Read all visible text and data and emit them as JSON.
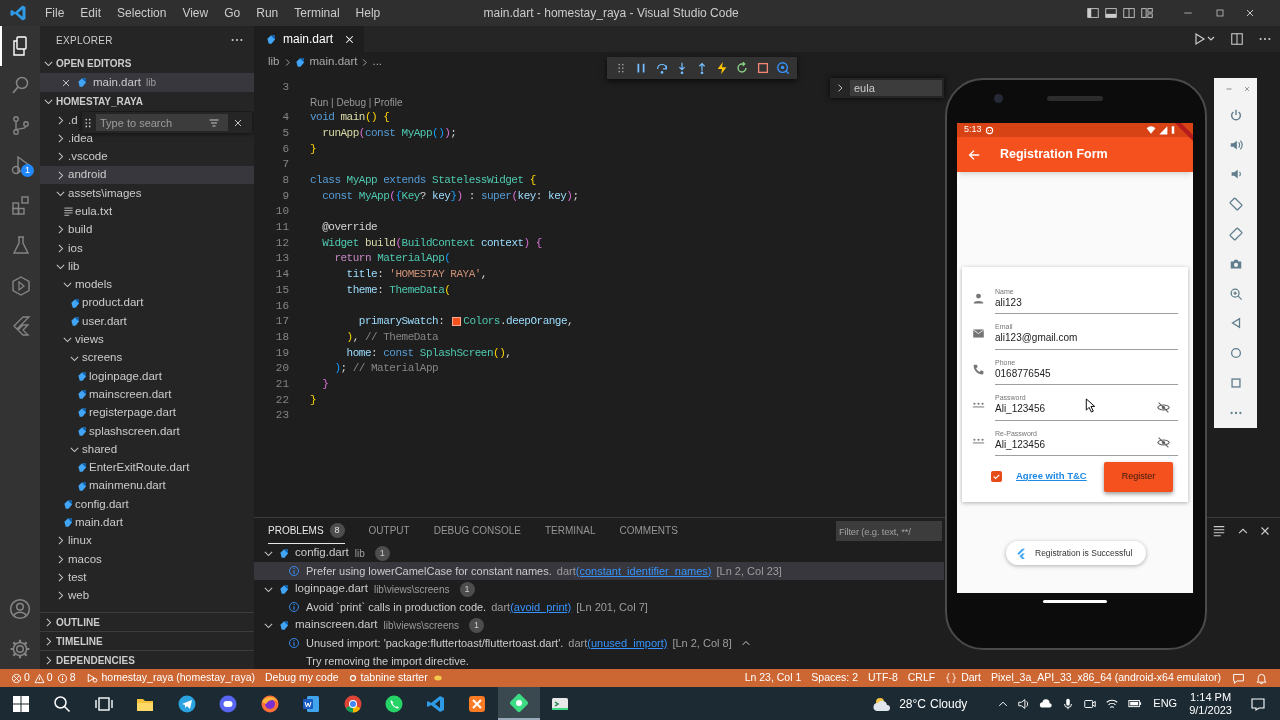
{
  "window": {
    "title": "main.dart - homestay_raya - Visual Studio Code"
  },
  "menu": [
    "File",
    "Edit",
    "Selection",
    "View",
    "Go",
    "Run",
    "Terminal",
    "Help"
  ],
  "activity_bar": [
    {
      "kind": "explorer",
      "selected": true
    },
    {
      "kind": "search",
      "selected": false
    },
    {
      "kind": "source-control",
      "selected": false
    },
    {
      "kind": "run-debug",
      "selected": false,
      "badge": "1"
    },
    {
      "kind": "extensions",
      "selected": false
    },
    {
      "kind": "testing",
      "selected": false
    },
    {
      "kind": "remote",
      "selected": false
    },
    {
      "kind": "flutter",
      "selected": false
    }
  ],
  "activity_bar_bottom": [
    {
      "kind": "account"
    },
    {
      "kind": "settings"
    }
  ],
  "sidebar": {
    "title": "EXPLORER",
    "open_editors": {
      "header": "OPEN EDITORS",
      "expanded": true,
      "items": [
        {
          "name": "main.dart",
          "path": "lib",
          "selected": true
        }
      ]
    },
    "project": {
      "header": "HOMESTAY_RAYA",
      "expanded": true,
      "tree": [
        {
          "name": ".d",
          "kind": "folder",
          "expanded": false,
          "selected": false
        },
        {
          "name": ".idea",
          "kind": "folder",
          "expanded": false,
          "selected": false
        },
        {
          "name": ".vscode",
          "kind": "folder",
          "expanded": false,
          "selected": false
        },
        {
          "name": "android",
          "kind": "folder",
          "expanded": false,
          "selected": true
        },
        {
          "name": "assets\\images",
          "kind": "folder",
          "expanded": true,
          "selected": false,
          "children": [
            {
              "name": "eula.txt",
              "kind": "text",
              "selected": false
            }
          ]
        },
        {
          "name": "build",
          "kind": "folder",
          "expanded": false,
          "selected": false
        },
        {
          "name": "ios",
          "kind": "folder",
          "expanded": false,
          "selected": false
        },
        {
          "name": "lib",
          "kind": "folder",
          "expanded": true,
          "selected": false,
          "children": [
            {
              "name": "models",
              "kind": "folder",
              "expanded": true,
              "selected": false,
              "children": [
                {
                  "name": "product.dart",
                  "kind": "dart",
                  "selected": false
                },
                {
                  "name": "user.dart",
                  "kind": "dart",
                  "selected": false
                }
              ]
            },
            {
              "name": "views",
              "kind": "folder",
              "expanded": true,
              "selected": false,
              "children": [
                {
                  "name": "screens",
                  "kind": "folder",
                  "expanded": true,
                  "selected": false,
                  "children": [
                    {
                      "name": "loginpage.dart",
                      "kind": "dart",
                      "selected": false
                    },
                    {
                      "name": "mainscreen.dart",
                      "kind": "dart",
                      "selected": false
                    },
                    {
                      "name": "registerpage.dart",
                      "kind": "dart",
                      "selected": false
                    },
                    {
                      "name": "splashscreen.dart",
                      "kind": "dart",
                      "selected": false
                    }
                  ]
                },
                {
                  "name": "shared",
                  "kind": "folder",
                  "expanded": true,
                  "selected": false,
                  "children": [
                    {
                      "name": "EnterExitRoute.dart",
                      "kind": "dart",
                      "selected": false
                    },
                    {
                      "name": "mainmenu.dart",
                      "kind": "dart",
                      "selected": false
                    }
                  ]
                }
              ]
            },
            {
              "name": "config.dart",
              "kind": "dart",
              "selected": false
            },
            {
              "name": "main.dart",
              "kind": "dart",
              "selected": false
            }
          ]
        },
        {
          "name": "linux",
          "kind": "folder",
          "expanded": false,
          "selected": false
        },
        {
          "name": "macos",
          "kind": "folder",
          "expanded": false,
          "selected": false
        },
        {
          "name": "test",
          "kind": "folder",
          "expanded": false,
          "selected": false
        },
        {
          "name": "web",
          "kind": "folder",
          "expanded": false,
          "selected": false
        }
      ]
    },
    "search_widget": {
      "placeholder": "Type to search"
    },
    "sections": [
      {
        "header": "OUTLINE",
        "expanded": false
      },
      {
        "header": "TIMELINE",
        "expanded": false
      },
      {
        "header": "DEPENDENCIES",
        "expanded": false
      }
    ]
  },
  "editor": {
    "tabs": [
      {
        "label": "main.dart",
        "selected": true
      }
    ],
    "breadcrumb": [
      "lib",
      "main.dart",
      "..."
    ],
    "find_widget": {
      "value": "eula"
    },
    "lines": [
      {
        "kind": "code",
        "number": "3"
      },
      {
        "kind": "codelens",
        "text": "Run | Debug | Profile"
      },
      {
        "kind": "code",
        "number": "4",
        "tokens": [
          {
            "text": "void ",
            "kind": "keyword"
          },
          {
            "text": "main",
            "kind": "function"
          },
          {
            "text": "() {",
            "kind": "bracket1"
          }
        ]
      },
      {
        "kind": "code",
        "number": "5",
        "tokens": [
          {
            "text": "  runApp",
            "kind": "function"
          },
          {
            "text": "(",
            "kind": "bracket2"
          },
          {
            "text": "const ",
            "kind": "keyword"
          },
          {
            "text": "MyApp",
            "kind": "type"
          },
          {
            "text": "()",
            "kind": "bracket3"
          },
          {
            "text": ")",
            "kind": "bracket2"
          },
          {
            "text": ";",
            "kind": "plain"
          }
        ]
      },
      {
        "kind": "code",
        "number": "6",
        "tokens": [
          {
            "text": "}",
            "kind": "bracket1"
          }
        ]
      },
      {
        "kind": "code",
        "number": "7"
      },
      {
        "kind": "code",
        "number": "8",
        "tokens": [
          {
            "text": "class ",
            "kind": "keyword"
          },
          {
            "text": "MyApp ",
            "kind": "type"
          },
          {
            "text": "extends ",
            "kind": "keyword"
          },
          {
            "text": "StatelessWidget ",
            "kind": "type"
          },
          {
            "text": "{",
            "kind": "bracket1"
          }
        ]
      },
      {
        "kind": "code",
        "number": "9",
        "tokens": [
          {
            "text": "  const ",
            "kind": "keyword"
          },
          {
            "text": "MyApp",
            "kind": "type"
          },
          {
            "text": "(",
            "kind": "bracket2"
          },
          {
            "text": "{",
            "kind": "bracket3"
          },
          {
            "text": "Key",
            "kind": "type"
          },
          {
            "text": "? ",
            "kind": "plain"
          },
          {
            "text": "key",
            "kind": "variable"
          },
          {
            "text": "}",
            "kind": "bracket3"
          },
          {
            "text": ")",
            "kind": "bracket2"
          },
          {
            "text": " : ",
            "kind": "plain"
          },
          {
            "text": "super",
            "kind": "keyword"
          },
          {
            "text": "(",
            "kind": "bracket2"
          },
          {
            "text": "key",
            "kind": "variable"
          },
          {
            "text": ": ",
            "kind": "plain"
          },
          {
            "text": "key",
            "kind": "variable"
          },
          {
            "text": ")",
            "kind": "bracket2"
          },
          {
            "text": ";",
            "kind": "plain"
          }
        ]
      },
      {
        "kind": "code",
        "number": "10"
      },
      {
        "kind": "code",
        "number": "11",
        "tokens": [
          {
            "text": "  @override",
            "kind": "plain"
          }
        ]
      },
      {
        "kind": "code",
        "number": "12",
        "tokens": [
          {
            "text": "  Widget ",
            "kind": "type"
          },
          {
            "text": "build",
            "kind": "function"
          },
          {
            "text": "(",
            "kind": "bracket2"
          },
          {
            "text": "BuildContext ",
            "kind": "type"
          },
          {
            "text": "context",
            "kind": "variable"
          },
          {
            "text": ")",
            "kind": "bracket2"
          },
          {
            "text": " {",
            "kind": "bracket2"
          }
        ]
      },
      {
        "kind": "code",
        "number": "13",
        "tokens": [
          {
            "text": "    return ",
            "kind": "control"
          },
          {
            "text": "MaterialApp",
            "kind": "type"
          },
          {
            "text": "(",
            "kind": "bracket3"
          }
        ]
      },
      {
        "kind": "code",
        "number": "14",
        "tokens": [
          {
            "text": "      title",
            "kind": "variable"
          },
          {
            "text": ": ",
            "kind": "plain"
          },
          {
            "text": "'HOMESTAY RAYA'",
            "kind": "string"
          },
          {
            "text": ",",
            "kind": "plain"
          }
        ]
      },
      {
        "kind": "code",
        "number": "15",
        "tokens": [
          {
            "text": "      theme",
            "kind": "variable"
          },
          {
            "text": ": ",
            "kind": "plain"
          },
          {
            "text": "ThemeData",
            "kind": "type"
          },
          {
            "text": "(",
            "kind": "bracket1"
          }
        ]
      },
      {
        "kind": "code",
        "number": "16"
      },
      {
        "kind": "code",
        "number": "17",
        "tokens": [
          {
            "text": "        primarySwatch",
            "kind": "variable"
          },
          {
            "text": ": ",
            "kind": "plain"
          },
          {
            "kind": "swatch",
            "color": "#f4511e"
          },
          {
            "text": "Colors",
            "kind": "type"
          },
          {
            "text": ".",
            "kind": "plain"
          },
          {
            "text": "deepOrange",
            "kind": "variable"
          },
          {
            "text": ",",
            "kind": "plain"
          }
        ]
      },
      {
        "kind": "code",
        "number": "18",
        "tokens": [
          {
            "text": "      )",
            "kind": "bracket1"
          },
          {
            "text": ", ",
            "kind": "plain"
          },
          {
            "text": "// ThemeData",
            "kind": "comment"
          }
        ]
      },
      {
        "kind": "code",
        "number": "19",
        "tokens": [
          {
            "text": "      home",
            "kind": "variable"
          },
          {
            "text": ": ",
            "kind": "plain"
          },
          {
            "text": "const ",
            "kind": "keyword"
          },
          {
            "text": "SplashScreen",
            "kind": "type"
          },
          {
            "text": "()",
            "kind": "bracket1"
          },
          {
            "text": ",",
            "kind": "plain"
          }
        ]
      },
      {
        "kind": "code",
        "number": "20",
        "tokens": [
          {
            "text": "    )",
            "kind": "bracket3"
          },
          {
            "text": "; ",
            "kind": "plain"
          },
          {
            "text": "// MaterialApp",
            "kind": "comment"
          }
        ]
      },
      {
        "kind": "code",
        "number": "21",
        "tokens": [
          {
            "text": "  }",
            "kind": "bracket2"
          }
        ]
      },
      {
        "kind": "code",
        "number": "22",
        "tokens": [
          {
            "text": "}",
            "kind": "bracket1"
          }
        ]
      },
      {
        "kind": "code",
        "number": "23"
      }
    ]
  },
  "panel": {
    "tabs": [
      {
        "label": "PROBLEMS",
        "badge": "8",
        "selected": true
      },
      {
        "label": "OUTPUT",
        "selected": false
      },
      {
        "label": "DEBUG CONSOLE",
        "selected": false
      },
      {
        "label": "TERMINAL",
        "selected": false
      },
      {
        "label": "COMMENTS",
        "selected": false
      }
    ],
    "filter": {
      "placeholder": "Filter (e.g. text, **/"
    },
    "problem_groups": [
      {
        "file": "config.dart",
        "path": "lib",
        "count": "1",
        "expanded": true,
        "problems": [
          {
            "message": "Prefer using lowerCamelCase for constant names.",
            "source": "dart",
            "rule": "(constant_identifier_names)",
            "location": "[Ln 2, Col 23]",
            "selected": true,
            "collapse_button": false
          }
        ]
      },
      {
        "file": "loginpage.dart",
        "path": "lib\\views\\screens",
        "count": "1",
        "expanded": true,
        "problems": [
          {
            "message": "Avoid `print` calls in production code.",
            "source": "dart",
            "rule": "(avoid_print)",
            "location": "[Ln 201, Col 7]",
            "selected": false,
            "collapse_button": false
          }
        ]
      },
      {
        "file": "mainscreen.dart",
        "path": "lib\\views\\screens",
        "count": "1",
        "expanded": true,
        "problems": [
          {
            "message": "Unused import: 'package:fluttertoast/fluttertoast.dart'.",
            "source": "dart",
            "rule": "(unused_import)",
            "location": "[Ln 2, Col 8]",
            "selected": false,
            "collapse_button": true,
            "detail": "Try removing the import directive."
          }
        ]
      }
    ]
  },
  "status_bar": {
    "left": [
      {
        "kind": "problems",
        "errors": "0",
        "warnings": "0",
        "infos": "8"
      },
      {
        "kind": "debug",
        "text": "homestay_raya (homestay_raya)"
      },
      {
        "kind": "plain",
        "text": "Debug my code"
      },
      {
        "kind": "tabnine",
        "text": "tabnine starter"
      }
    ],
    "right": [
      {
        "kind": "plain",
        "text": "Ln 23, Col 1"
      },
      {
        "kind": "plain",
        "text": "Spaces: 2"
      },
      {
        "kind": "plain",
        "text": "UTF-8"
      },
      {
        "kind": "plain",
        "text": "CRLF"
      },
      {
        "kind": "language",
        "text": "Dart"
      },
      {
        "kind": "plain",
        "text": "Pixel_3a_API_33_x86_64 (android-x64 emulator)"
      }
    ]
  },
  "phone": {
    "status_time": "5:13",
    "app_bar_title": "Registration Form",
    "fields": [
      {
        "kind": "person",
        "label": "Name",
        "value": "ali123",
        "visibility_toggle": false
      },
      {
        "kind": "email",
        "label": "Email",
        "value": "ali123@gmail.com",
        "visibility_toggle": false
      },
      {
        "kind": "phone",
        "label": "Phone",
        "value": "0168776545",
        "visibility_toggle": false
      },
      {
        "kind": "password",
        "label": "Password",
        "value": "Ali_123456",
        "visibility_toggle": true
      },
      {
        "kind": "password",
        "label": "Re-Password",
        "value": "Ali_123456",
        "visibility_toggle": true
      }
    ],
    "agree": {
      "checked": true,
      "link": "Agree with T&C"
    },
    "button": "Register",
    "toast": "Registration is Successful"
  },
  "taskbar": {
    "apps": [
      {
        "kind": "start",
        "selected": false
      },
      {
        "kind": "search",
        "selected": false
      },
      {
        "kind": "task-view",
        "selected": false
      },
      {
        "kind": "folder",
        "selected": false
      },
      {
        "kind": "plane",
        "selected": false
      },
      {
        "kind": "purple",
        "selected": false
      },
      {
        "kind": "fox",
        "selected": false
      },
      {
        "kind": "word",
        "selected": false
      },
      {
        "kind": "chrome",
        "selected": false
      },
      {
        "kind": "whatsapp",
        "selected": false
      },
      {
        "kind": "vscode",
        "selected": false
      },
      {
        "kind": "xampp",
        "selected": false
      },
      {
        "kind": "diamond",
        "selected": true
      },
      {
        "kind": "terminal",
        "selected": false
      }
    ],
    "weather": {
      "temperature": "28°C",
      "condition": "Cloudy"
    },
    "language": "ENG",
    "time": "1:14 PM",
    "date": "9/1/2023"
  }
}
